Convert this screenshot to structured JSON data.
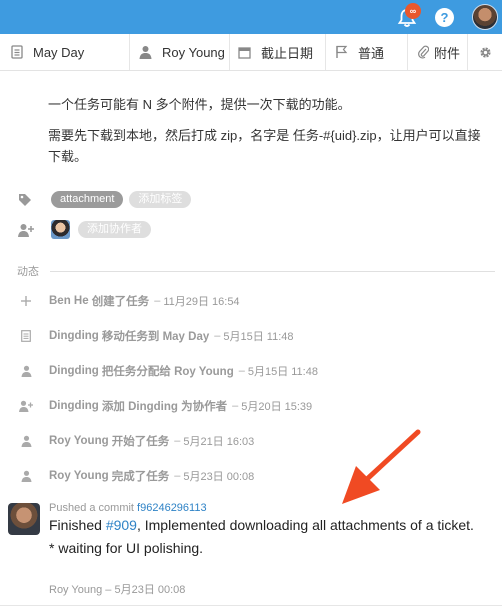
{
  "header": {
    "notification_count": "∞",
    "help_label": "?"
  },
  "meta": {
    "list": "May Day",
    "assignee": "Roy Young",
    "due": "截止日期",
    "priority": "普通",
    "attachment": "附件"
  },
  "description": {
    "p1": "一个任务可能有 N 多个附件，提供一次下载的功能。",
    "p2": "需要先下载到本地，然后打成 zip，名字是 任务-#{uid}.zip，让用户可以直接下载。"
  },
  "tags": {
    "items": [
      "attachment"
    ],
    "add_label": "添加标签"
  },
  "collaborators": {
    "add_label": "添加协作者"
  },
  "activity": {
    "title": "动态",
    "items": [
      {
        "icon": "plus-icon",
        "actor": "Ben He",
        "action": "创建了任务",
        "time": "11月29日 16:54"
      },
      {
        "icon": "list-icon",
        "actor": "Dingding",
        "action": "移动任务到 May Day",
        "time": "5月15日 11:48"
      },
      {
        "icon": "user-icon",
        "actor": "Dingding",
        "action": "把任务分配给 Roy Young",
        "time": "5月15日 11:48"
      },
      {
        "icon": "user-add-icon",
        "actor": "Dingding",
        "action": "添加 Dingding 为协作者",
        "time": "5月20日 15:39"
      },
      {
        "icon": "user-icon",
        "actor": "Roy Young",
        "action": "开始了任务",
        "time": "5月21日 16:03"
      },
      {
        "icon": "user-icon",
        "actor": "Roy Young",
        "action": "完成了任务",
        "time": "5月23日 00:08"
      }
    ]
  },
  "comment": {
    "pushed_prefix": "Pushed a commit",
    "commit_hash": "f96246296113",
    "line1_prefix": "Finished",
    "issue_ref": "#909",
    "line1_suffix": ", Implemented downloading all attachments of a ticket.",
    "line2": "* waiting for UI polishing.",
    "author": "Roy Young",
    "time": "5月23日 00:08"
  },
  "colors": {
    "topbar": "#3e9be0",
    "badge": "#e9582d",
    "link": "#2f83c6",
    "arrow": "#f04a23"
  }
}
